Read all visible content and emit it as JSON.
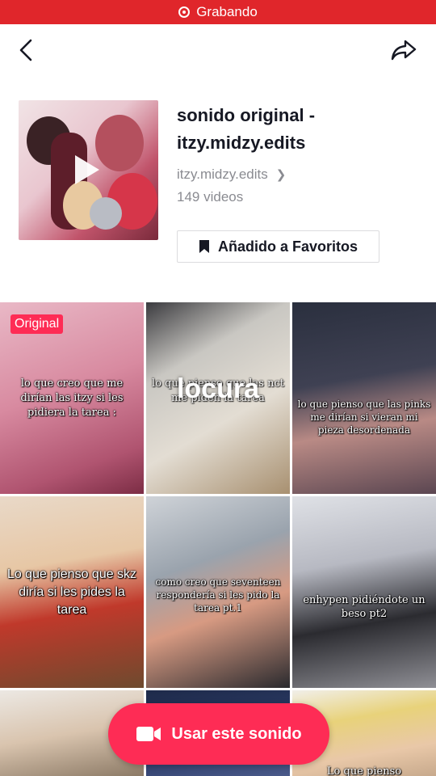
{
  "status": {
    "recording_label": "Grabando"
  },
  "sound": {
    "title": "sonido original - itzy.midzy.edits",
    "author": "itzy.midzy.edits",
    "video_count": "149 videos",
    "favorite_label": "Añadido a Favoritos"
  },
  "grid": {
    "original_badge": "Original",
    "tiles": [
      {
        "caption": "lo que creo que me dirían las itzy si les pidiera la tarea :"
      },
      {
        "caption": "lo que pienso que las nct me piden la tarea",
        "overlay": "locura"
      },
      {
        "caption": "lo que pienso que las pinks me dirían si vieran mi pieza desordenada"
      },
      {
        "caption": "Lo que pienso que skz diría si les pides la tarea"
      },
      {
        "caption": "como creo que seventeen respondería si les pido la tarea pt.1"
      },
      {
        "caption": "enhypen pidiéndote un beso pt2"
      },
      {
        "caption": ""
      },
      {
        "caption": ""
      },
      {
        "caption": "Lo que pienso"
      }
    ]
  },
  "cta": {
    "label": "Usar este sonido"
  },
  "colors": {
    "accent": "#fe2c55",
    "recording": "#e0262b"
  }
}
